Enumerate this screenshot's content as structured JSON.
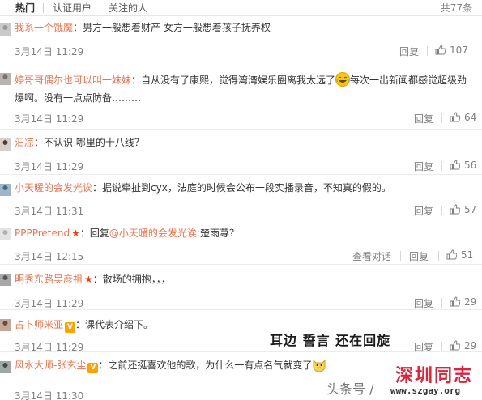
{
  "tabs": [
    "热门",
    "认证用户",
    "关注的人"
  ],
  "total_label": "共77条",
  "actions": {
    "reply": "回复",
    "view_conversation": "查看对话"
  },
  "comments": [
    {
      "user": "我系一个饿魔",
      "text": "：男方一般想着财产 女方一般想着孩子抚养权",
      "time": "3月14日 11:29",
      "likes": "107"
    },
    {
      "user": "婷哥哥偶尔也可以叫一妹妹",
      "text_a": "：自从没有了康熙，觉得湾湾娱乐圈离我太远了",
      "text_b": "每次一出新闻都感觉超级劲爆啊。没有一点点防备………",
      "time": "3月14日 11:29",
      "likes": "64"
    },
    {
      "user": "汨凉",
      "text": "：不认识 哪里的十八线？",
      "time": "3月14日 11:29",
      "likes": "56"
    },
    {
      "user": "小天暖的会发光诶",
      "text": "：据说牵扯到cyx，法庭的时候会公布一段实播录音，不知真的假的。",
      "time": "3月14日 11:31",
      "likes": "57"
    },
    {
      "user": "PPPPretend",
      "text_a": "：回复",
      "mention": "@小天暖的会发光诶",
      "text_b": ":楚雨荨？",
      "time": "3月14日 12:15",
      "likes": "51"
    },
    {
      "user": "明秀东路吴彦祖",
      "text": "：散场的拥抱，，，",
      "time": "3月14日 11:29",
      "likes": "29"
    },
    {
      "user": "占卜师米亚",
      "text": "：课代表介绍下。",
      "time": "3月14日 11:29",
      "likes": "29"
    },
    {
      "user": "风水大师-张玄尘",
      "text": "：之前还挺喜欢他的歌，为什么一有点名气就变了",
      "time": "3月14日 11:30",
      "likes": ""
    }
  ],
  "overlay_caption": "耳边 誓言 还在回旋",
  "watermark": {
    "left": "头条号 /",
    "right": "深圳同志",
    "url": "www.szgay.org"
  },
  "colors": {
    "username": "#eb7350",
    "meta": "#808080",
    "star": "#ef3c14",
    "vbadge": "#ffa200",
    "watermark_red": "#d7263d"
  }
}
